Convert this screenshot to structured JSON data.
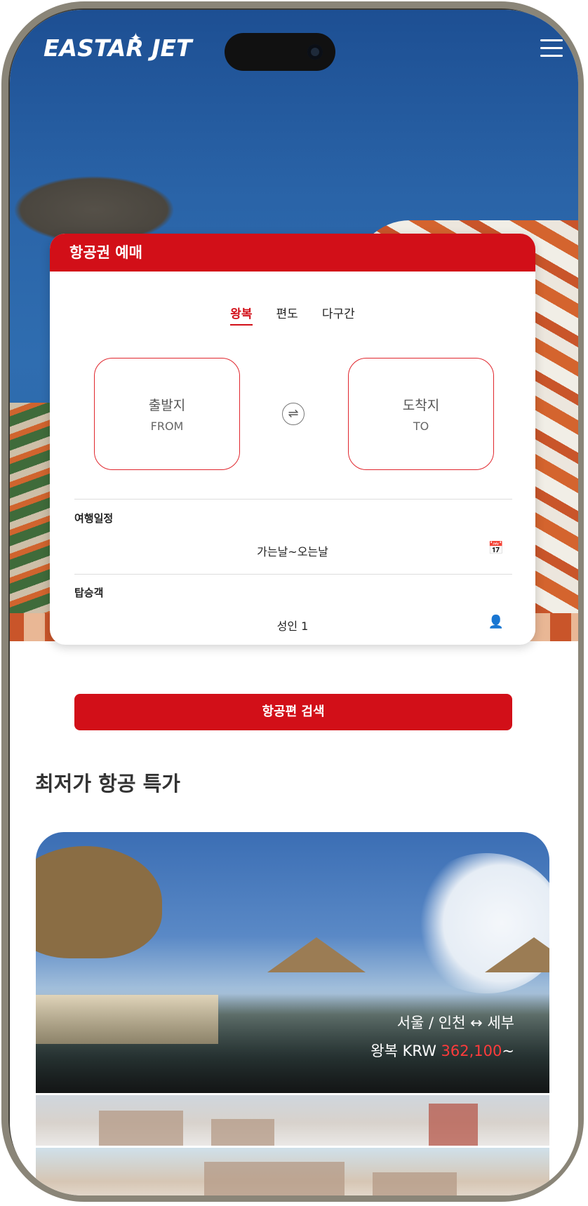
{
  "brand": {
    "logo_text": "EASTAR JET"
  },
  "booking": {
    "title": "항공권 예매",
    "tabs": [
      {
        "label": "왕복",
        "active": true
      },
      {
        "label": "편도",
        "active": false
      },
      {
        "label": "다구간",
        "active": false
      }
    ],
    "from": {
      "label_ko": "출발지",
      "label_en": "FROM"
    },
    "to": {
      "label_ko": "도착지",
      "label_en": "TO"
    },
    "schedule": {
      "label": "여행일정",
      "value": "가는날~오는날"
    },
    "passengers": {
      "label": "탑승객",
      "value": "성인 1"
    },
    "search_label": "항공편 검색"
  },
  "deals": {
    "section_title": "최저가 항공 특가",
    "featured": {
      "route": "서울 / 인천 ↔ 세부",
      "price_prefix": "왕복 KRW ",
      "price": "362,100",
      "price_suffix": "~"
    }
  },
  "colors": {
    "brand_red": "#d20f18",
    "price_red": "#ff3b3b"
  }
}
